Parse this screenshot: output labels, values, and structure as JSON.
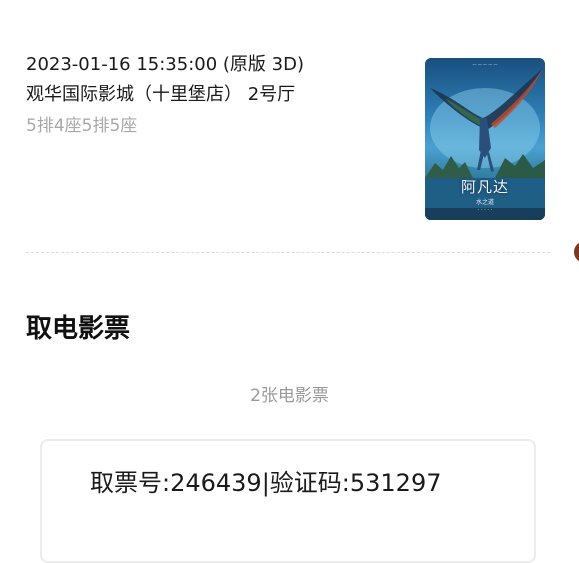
{
  "order": {
    "showtime": "2023-01-16 15:35:00 (原版 3D)",
    "cinema": "观华国际影城（十里堡店） 2号厅",
    "seats": "5排4座5排5座"
  },
  "poster": {
    "title": "阿凡达",
    "subtitle": "水之道",
    "icon": "movie-poster-image"
  },
  "section": {
    "title": "取电影票"
  },
  "tickets": {
    "count_label": "2张电影票",
    "code_text": "取票号:246439|验证码:531297"
  },
  "colors": {
    "text_primary": "#1a1a1a",
    "text_secondary": "#a8a8a8",
    "divider": "#dcdcdc",
    "card_border": "#ececec"
  }
}
